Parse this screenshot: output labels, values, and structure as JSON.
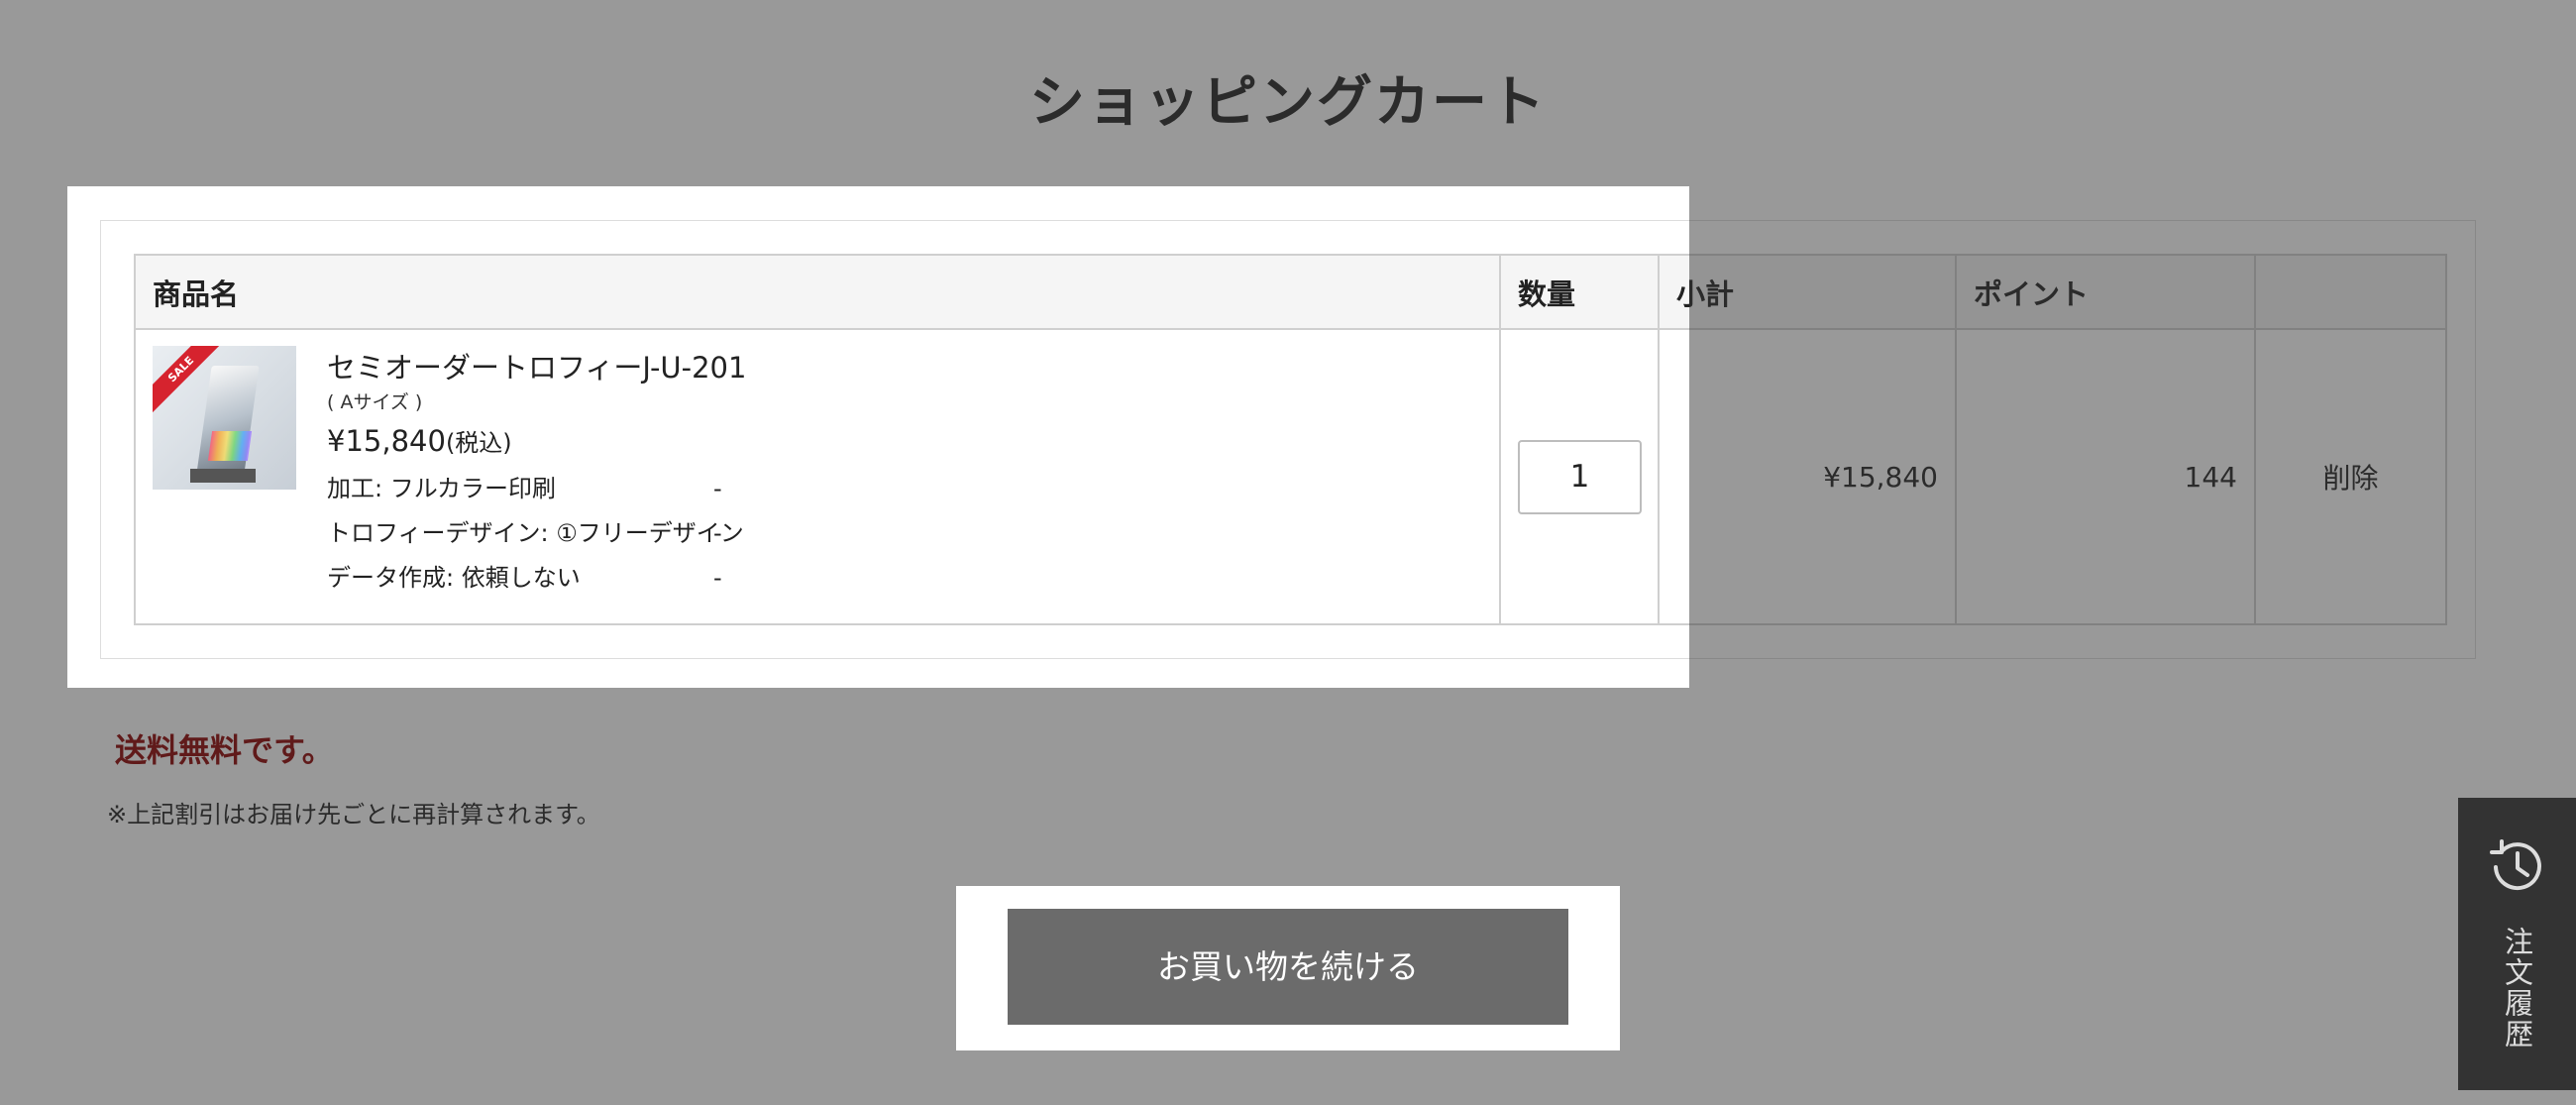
{
  "page": {
    "title": "ショッピングカート"
  },
  "cart": {
    "columns": {
      "product": "商品名",
      "quantity": "数量",
      "subtotal": "小計",
      "points": "ポイント",
      "action": ""
    },
    "item": {
      "badge": "SALE",
      "name": "セミオーダートロフィーJ-U-201",
      "size": "( Aサイズ )",
      "price": "¥15,840",
      "tax_note": "(税込)",
      "options": [
        {
          "label": "加工: フルカラー印刷",
          "value": "-"
        },
        {
          "label": "トロフィーデザイン: ①フリーデザイン",
          "value": "-"
        },
        {
          "label": "データ作成: 依頼しない",
          "value": "-"
        }
      ],
      "quantity": "1",
      "subtotal": "¥15,840",
      "points": "144",
      "delete_label": "削除"
    }
  },
  "shipping": {
    "free_notice": "送料無料です。",
    "note": "※上記割引はお届け先ごとに再計算されます。"
  },
  "actions": {
    "continue_shopping": "お買い物を続ける"
  },
  "side_tab": {
    "icon": "history-clock-icon",
    "label": "注文履歴"
  },
  "colors": {
    "overlay": "#333333",
    "free_notice": "#8c0000",
    "button_bg": "#6b6b6b",
    "side_tab_bg": "#333333"
  }
}
